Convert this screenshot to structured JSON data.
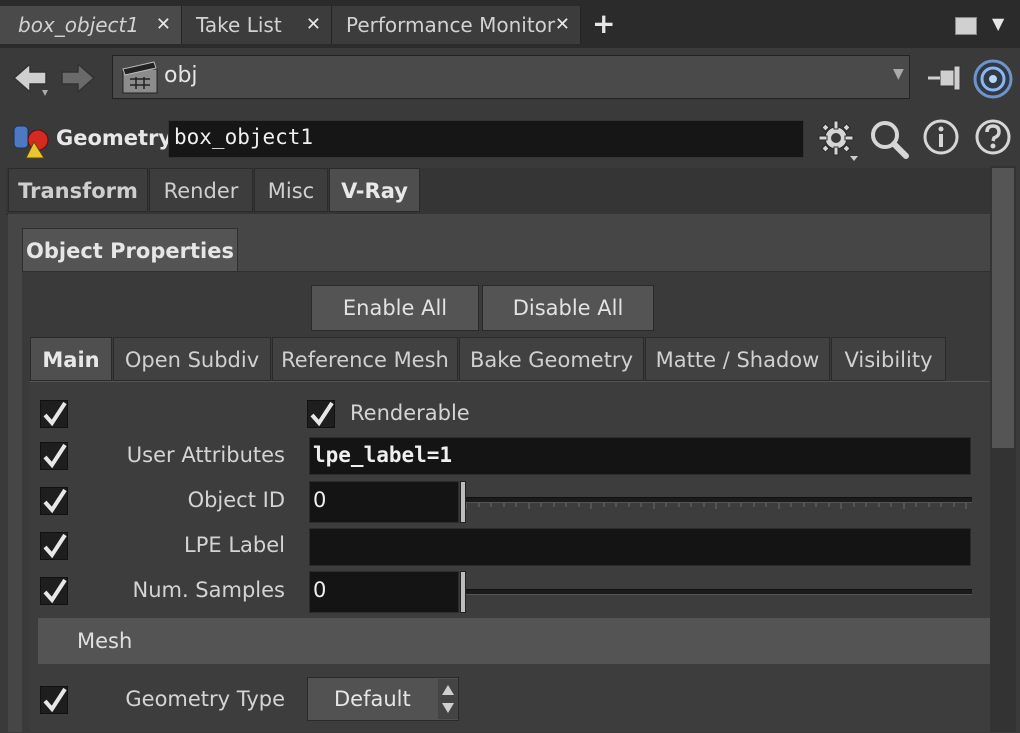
{
  "pane_tabs": [
    {
      "label": "box_object1",
      "close": "✕"
    },
    {
      "label": "Take List",
      "close": "✕"
    },
    {
      "label": "Performance Monitor",
      "close": "✕"
    }
  ],
  "pane_tabs_add": "+",
  "path": {
    "text": "obj"
  },
  "header": {
    "type_label": "Geometry",
    "node_name": "box_object1"
  },
  "top_tabs": [
    "Transform",
    "Render",
    "Misc",
    "V-Ray"
  ],
  "active_top_tab": "V-Ray",
  "object_properties_tab": "Object Properties",
  "buttons": {
    "enable_all": "Enable All",
    "disable_all": "Disable All"
  },
  "sub_tabs": [
    "Main",
    "Open Subdiv",
    "Reference Mesh",
    "Bake Geometry",
    "Matte / Shadow",
    "Visibility"
  ],
  "active_sub_tab": "Main",
  "params": {
    "renderable_label": "Renderable",
    "user_attributes_label": "User Attributes",
    "user_attributes_value": "lpe_label=1",
    "object_id_label": "Object ID",
    "object_id_value": "0",
    "lpe_label_label": "LPE Label",
    "lpe_label_value": "",
    "num_samples_label": "Num. Samples",
    "num_samples_value": "0"
  },
  "mesh_section": {
    "label": "Mesh",
    "geometry_type_label": "Geometry Type",
    "geometry_type_value": "Default"
  },
  "colors": {
    "panel": "#3a3a3a",
    "field": "#141414",
    "accent_red": "#d42a1f"
  }
}
